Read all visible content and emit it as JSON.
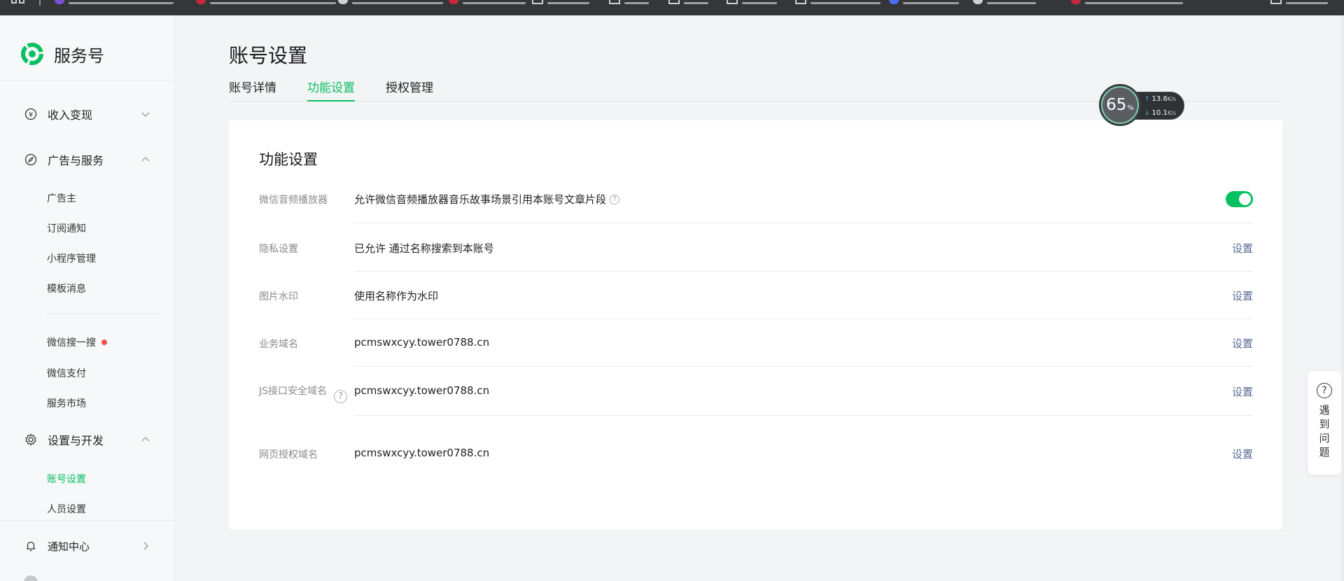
{
  "brand": {
    "name": "服务号",
    "accent": "#07c160",
    "link_color": "#576b95"
  },
  "sidebar": {
    "groups": [
      {
        "id": "income",
        "label": "收入变现",
        "icon": "yen-circle-icon",
        "expanded": false
      },
      {
        "id": "ads",
        "label": "广告与服务",
        "icon": "compass-icon",
        "expanded": true,
        "items": [
          {
            "label": "广告主"
          },
          {
            "label": "订阅通知"
          },
          {
            "label": "小程序管理"
          },
          {
            "label": "模板消息"
          },
          {
            "label": "微信搜一搜",
            "badge": "red-dot"
          },
          {
            "label": "微信支付"
          },
          {
            "label": "服务市场"
          }
        ]
      },
      {
        "id": "settings",
        "label": "设置与开发",
        "icon": "gear-icon",
        "expanded": true,
        "items": [
          {
            "label": "账号设置",
            "active": true
          },
          {
            "label": "人员设置"
          }
        ]
      },
      {
        "id": "notify",
        "label": "通知中心",
        "icon": "bell-icon"
      }
    ]
  },
  "page": {
    "title": "账号设置",
    "tabs": [
      {
        "label": "账号详情",
        "active": false
      },
      {
        "label": "功能设置",
        "active": true
      },
      {
        "label": "授权管理",
        "active": false
      }
    ]
  },
  "card": {
    "title": "功能设置",
    "rows": [
      {
        "label": "微信音频播放器",
        "value": "允许微信音频播放器音乐故事场景引用本账号文章片段",
        "help": "?",
        "control": "toggle",
        "toggle_on": true
      },
      {
        "label": "隐私设置",
        "value": "已允许 通过名称搜索到本账号",
        "action": "设置"
      },
      {
        "label": "图片水印",
        "value": "使用名称作为水印",
        "action": "设置"
      },
      {
        "label": "业务域名",
        "value": "pcmswxcyy.tower0788.cn",
        "action": "设置"
      },
      {
        "label": "JS接口安全域名",
        "value": "pcmswxcyy.tower0788.cn",
        "action": "设置",
        "help": "?"
      },
      {
        "label": "网页授权域名",
        "value": "pcmswxcyy.tower0788.cn",
        "action": "设置"
      }
    ]
  },
  "net_monitor": {
    "percent": "65",
    "percent_unit": "%",
    "upload": "13.6",
    "download": "10.1",
    "unit": "K/s"
  },
  "help_float": {
    "icon": "?",
    "label": "遇到问题",
    "chars": [
      "遇",
      "到",
      "问",
      "题"
    ]
  }
}
